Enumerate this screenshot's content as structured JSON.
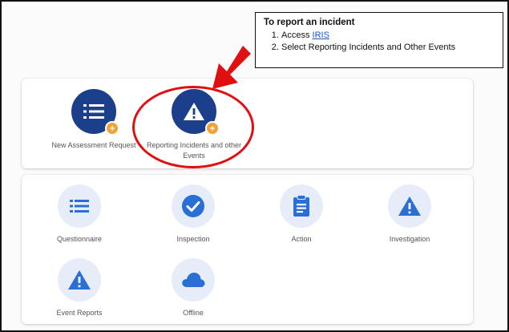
{
  "callout": {
    "title": "To report an incident",
    "step1_prefix": "Access",
    "step1_link": "IRIS",
    "step2": "Select Reporting Incidents and Other Events"
  },
  "top_tiles": [
    {
      "label": "New Assessment Request",
      "icon": "list-icon",
      "badge": "+"
    },
    {
      "label": "Reporting Incidents and other Events",
      "icon": "warning-icon",
      "badge": "+"
    }
  ],
  "bottom_tiles": [
    {
      "label": "Questionnaire",
      "icon": "list-icon"
    },
    {
      "label": "Inspection",
      "icon": "check-icon"
    },
    {
      "label": "Action",
      "icon": "clipboard-icon"
    },
    {
      "label": "Investigation",
      "icon": "warning-icon"
    },
    {
      "label": "Event Reports",
      "icon": "warning-icon"
    },
    {
      "label": "Offline",
      "icon": "cloud-icon"
    }
  ],
  "colors": {
    "primary_dark": "#1b3f8a",
    "primary": "#2a6fd6",
    "icon_bg": "#e6edf8",
    "badge": "#f4a035",
    "highlight": "#e01010"
  }
}
